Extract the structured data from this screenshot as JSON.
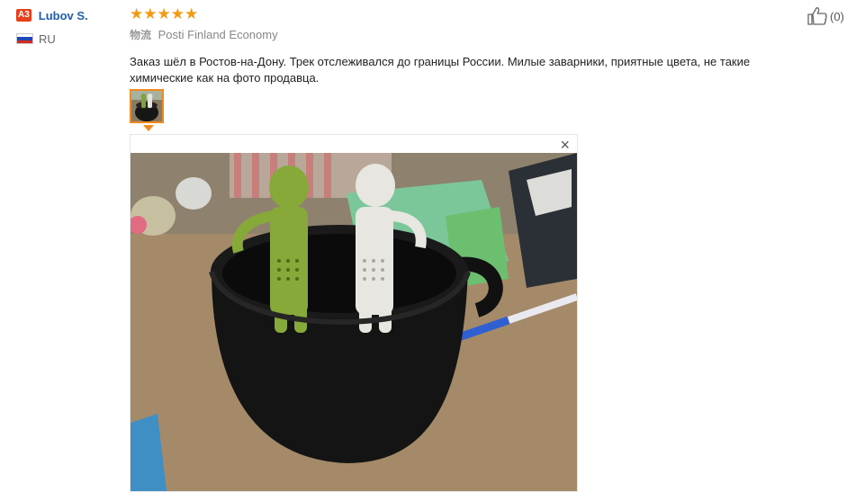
{
  "user": {
    "level_badge": "A3",
    "name": "Lubov S.",
    "country_code": "RU"
  },
  "feedback": {
    "rating": 5,
    "stars": [
      "★",
      "★",
      "★",
      "★",
      "★"
    ],
    "logistics_label": "物流",
    "logistics_value": "Posti Finland Economy",
    "text": "Заказ шёл в Ростов-на-Дону. Трек отслеживался до границы России. Милые заварники, приятные цвета, не такие химические как на фото продавца."
  },
  "viewer": {
    "close_label": "×"
  },
  "helpful": {
    "icon": "thumbs-up-icon",
    "count_label": "(0)"
  },
  "colors": {
    "accent": "#f08a1c",
    "star": "#f39a13",
    "link": "#1f5eae",
    "badge": "#e8401c"
  }
}
